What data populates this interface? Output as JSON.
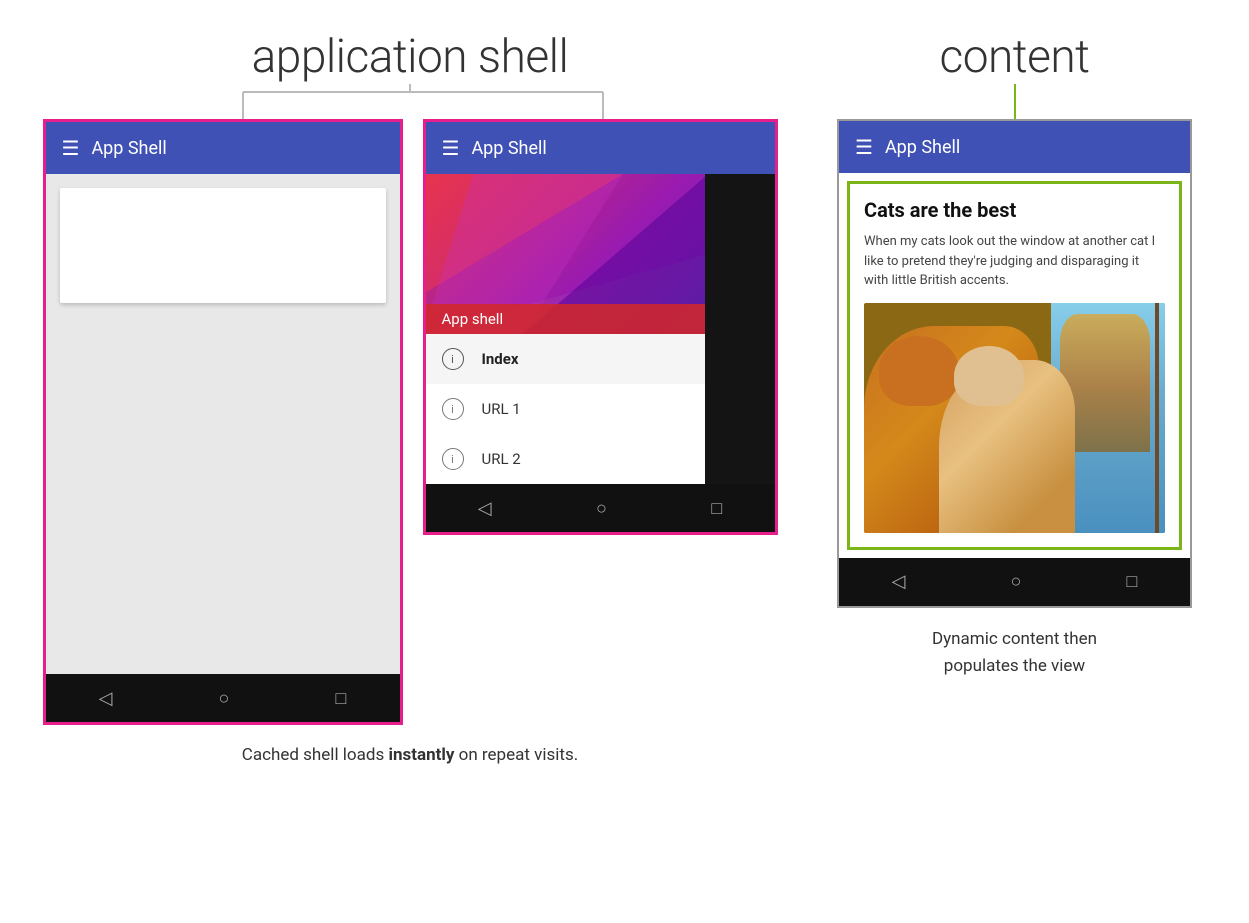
{
  "labels": {
    "app_shell_heading": "application shell",
    "content_heading": "content",
    "app_bar_title": "App Shell",
    "drawer_header_label": "App shell",
    "drawer_items": [
      {
        "label": "Index",
        "active": true
      },
      {
        "label": "URL 1",
        "active": false
      },
      {
        "label": "URL 2",
        "active": false
      }
    ],
    "caption_left": "Cached shell loads",
    "caption_bold": "instantly",
    "caption_right": "on repeat visits.",
    "right_caption_line1": "Dynamic content then",
    "right_caption_line2": "populates the view",
    "cats_title": "Cats are the best",
    "cats_text": "When my cats look out the window at another cat I like to pretend they're judging and disparaging it with little British accents.",
    "nav_back": "◁",
    "nav_home": "○",
    "nav_recent": "□"
  },
  "colors": {
    "pink_border": "#e81e8c",
    "blue_appbar": "#3f51b5",
    "green_border": "#7ab618",
    "dark_nav": "#111111",
    "connector_line": "#bbbbbb",
    "green_connector": "#7ab618"
  }
}
